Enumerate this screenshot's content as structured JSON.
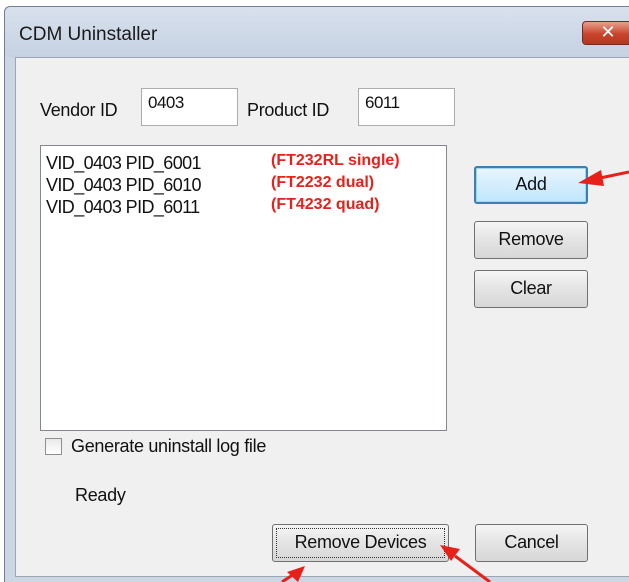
{
  "window": {
    "title": "CDM Uninstaller",
    "close_glyph": "✕"
  },
  "form": {
    "vendor_id_label": "Vendor ID",
    "vendor_id_value": "0403",
    "product_id_label": "Product ID",
    "product_id_value": "6011"
  },
  "device_list": [
    {
      "id": "VID_0403 PID_6001",
      "note": "(FT232RL single)"
    },
    {
      "id": "VID_0403 PID_6010",
      "note": "(FT2232 dual)"
    },
    {
      "id": "VID_0403 PID_6011",
      "note": "(FT4232 quad)"
    }
  ],
  "buttons": {
    "add": "Add",
    "remove": "Remove",
    "clear": "Clear",
    "remove_devices": "Remove Devices",
    "cancel": "Cancel"
  },
  "options": {
    "log_label": "Generate uninstall log file",
    "log_checked": false
  },
  "status": "Ready",
  "colors": {
    "annotation": "#e8201a",
    "accent": "#3c7fb1",
    "close": "#c7452b"
  }
}
